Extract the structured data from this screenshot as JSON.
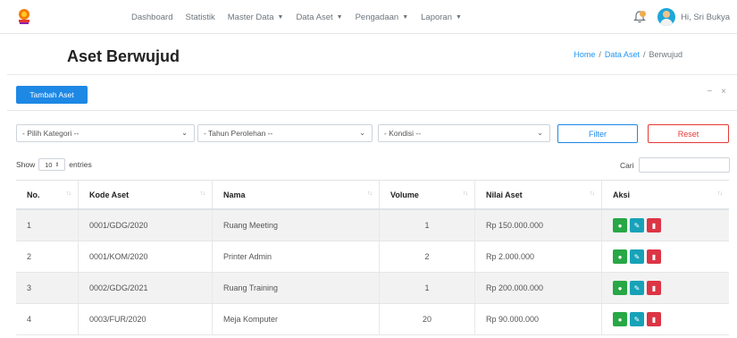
{
  "navbar": {
    "items": [
      {
        "label": "Dashboard",
        "dropdown": false
      },
      {
        "label": "Statistik",
        "dropdown": false
      },
      {
        "label": "Master Data",
        "dropdown": true
      },
      {
        "label": "Data Aset",
        "dropdown": true
      },
      {
        "label": "Pengadaan",
        "dropdown": true
      },
      {
        "label": "Laporan",
        "dropdown": true
      }
    ],
    "greeting": "Hi, Sri Bukya"
  },
  "page": {
    "title": "Aset Berwujud",
    "breadcrumb": [
      "Home",
      "Data Aset",
      "Berwujud"
    ]
  },
  "card": {
    "add_button": "Tambah Aset",
    "tools": [
      "−",
      "×"
    ]
  },
  "filters": {
    "kategori": "- Pilih Kategori --",
    "tahun": "- Tahun Perolehan --",
    "kondisi": "- Kondisi --",
    "filter_label": "Filter",
    "reset_label": "Reset"
  },
  "table_controls": {
    "show_label": "Show",
    "page_size": "10",
    "entries_label": "entries",
    "search_label": "Cari"
  },
  "table": {
    "columns": [
      "No.",
      "Kode Aset",
      "Nama",
      "Volume",
      "Nilai Aset",
      "Aksi"
    ],
    "rows": [
      {
        "no": "1",
        "kode": "0001/GDG/2020",
        "nama": "Ruang Meeting",
        "volume": "1",
        "nilai": "Rp 150.000.000"
      },
      {
        "no": "2",
        "kode": "0001/KOM/2020",
        "nama": "Printer Admin",
        "volume": "2",
        "nilai": "Rp 2.000.000"
      },
      {
        "no": "3",
        "kode": "0002/GDG/2021",
        "nama": "Ruang Training",
        "volume": "1",
        "nilai": "Rp 200.000.000"
      },
      {
        "no": "4",
        "kode": "0003/FUR/2020",
        "nama": "Meja Komputer",
        "volume": "20",
        "nilai": "Rp 90.000.000"
      }
    ]
  },
  "colors": {
    "primary": "#1e88e5",
    "danger": "#e53935",
    "view": "#28a745",
    "edit": "#17a2b8",
    "delete": "#dc3545",
    "breadcrumb_link": "#2196f3"
  },
  "icons": {
    "logo": "app-logo-icon",
    "bell": "bell-icon",
    "avatar": "user-avatar-icon",
    "sort": "sort-icon",
    "view": "eye-icon",
    "edit": "edit-icon",
    "delete": "trash-icon"
  }
}
